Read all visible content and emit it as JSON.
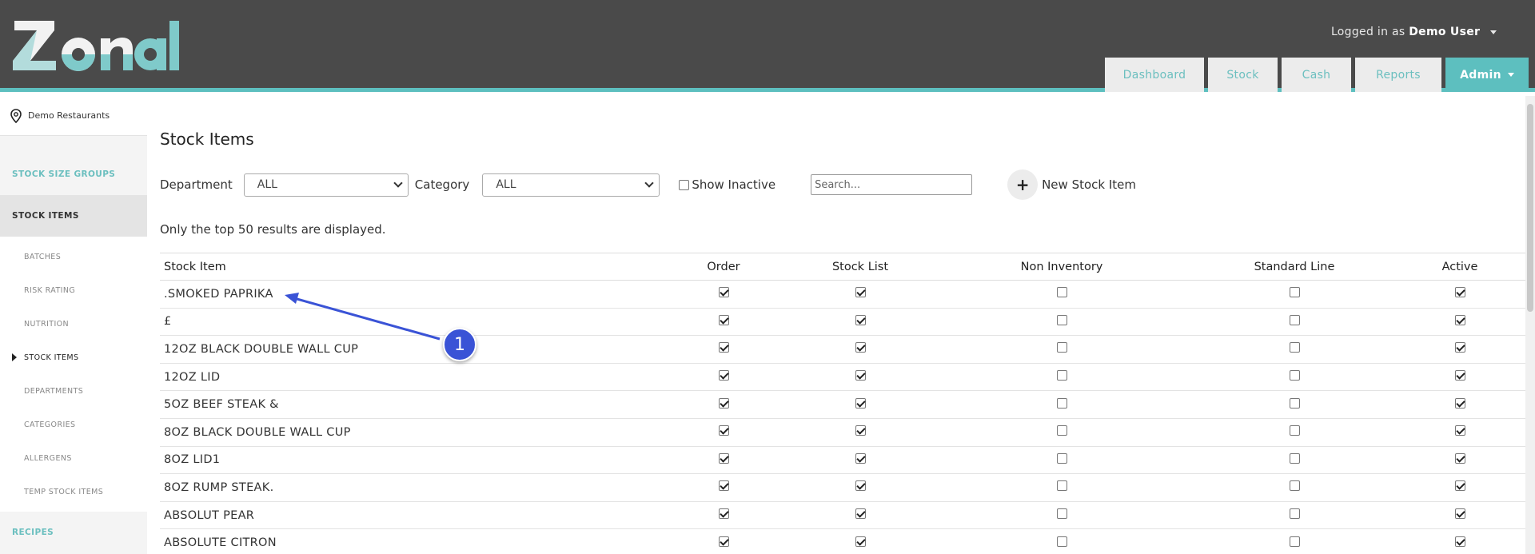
{
  "header": {
    "logo_text": "Zonal",
    "logged_in_prefix": "Logged in as",
    "user_name": "Demo User",
    "tabs": [
      {
        "label": "Dashboard"
      },
      {
        "label": "Stock"
      },
      {
        "label": "Cash"
      },
      {
        "label": "Reports"
      },
      {
        "label": "Admin"
      }
    ]
  },
  "sidebar": {
    "location": "Demo Restaurants",
    "items": [
      {
        "label": "STOCK SIZE GROUPS"
      },
      {
        "label": "STOCK ITEMS"
      },
      {
        "label": "BATCHES"
      },
      {
        "label": "RISK RATING"
      },
      {
        "label": "NUTRITION"
      },
      {
        "label": "STOCK ITEMS"
      },
      {
        "label": "DEPARTMENTS"
      },
      {
        "label": "CATEGORIES"
      },
      {
        "label": "ALLERGENS"
      },
      {
        "label": "TEMP STOCK ITEMS"
      },
      {
        "label": "RECIPES"
      }
    ]
  },
  "main": {
    "title": "Stock Items",
    "department_label": "Department",
    "department_value": "ALL",
    "category_label": "Category",
    "category_value": "ALL",
    "show_inactive_label": "Show Inactive",
    "search_placeholder": "Search...",
    "new_button_label": "New Stock Item",
    "note": "Only the top 50 results are displayed.",
    "columns": [
      "Stock Item",
      "Order",
      "Stock List",
      "Non Inventory",
      "Standard Line",
      "Active"
    ],
    "rows": [
      {
        "name": ".SMOKED PAPRIKA",
        "order": true,
        "stock_list": true,
        "non_inventory": false,
        "standard_line": false,
        "active": true
      },
      {
        "name": "£",
        "order": true,
        "stock_list": true,
        "non_inventory": false,
        "standard_line": false,
        "active": true
      },
      {
        "name": "12OZ BLACK DOUBLE WALL CUP",
        "order": true,
        "stock_list": true,
        "non_inventory": false,
        "standard_line": false,
        "active": true
      },
      {
        "name": "12OZ LID",
        "order": true,
        "stock_list": true,
        "non_inventory": false,
        "standard_line": false,
        "active": true
      },
      {
        "name": "5OZ BEEF STEAK &",
        "order": true,
        "stock_list": true,
        "non_inventory": false,
        "standard_line": false,
        "active": true
      },
      {
        "name": "8OZ BLACK DOUBLE WALL CUP",
        "order": true,
        "stock_list": true,
        "non_inventory": false,
        "standard_line": false,
        "active": true
      },
      {
        "name": "8OZ LID1",
        "order": true,
        "stock_list": true,
        "non_inventory": false,
        "standard_line": false,
        "active": true
      },
      {
        "name": "8OZ RUMP STEAK.",
        "order": true,
        "stock_list": true,
        "non_inventory": false,
        "standard_line": false,
        "active": true
      },
      {
        "name": "ABSOLUT PEAR",
        "order": true,
        "stock_list": true,
        "non_inventory": false,
        "standard_line": false,
        "active": true
      },
      {
        "name": "ABSOLUTE CITRON",
        "order": true,
        "stock_list": true,
        "non_inventory": false,
        "standard_line": false,
        "active": true
      }
    ]
  },
  "annotation": {
    "number": "1"
  },
  "colors": {
    "teal": "#5dbfbf",
    "header_bg": "#4a4a4a",
    "annotation_blue": "#3a53d6"
  }
}
